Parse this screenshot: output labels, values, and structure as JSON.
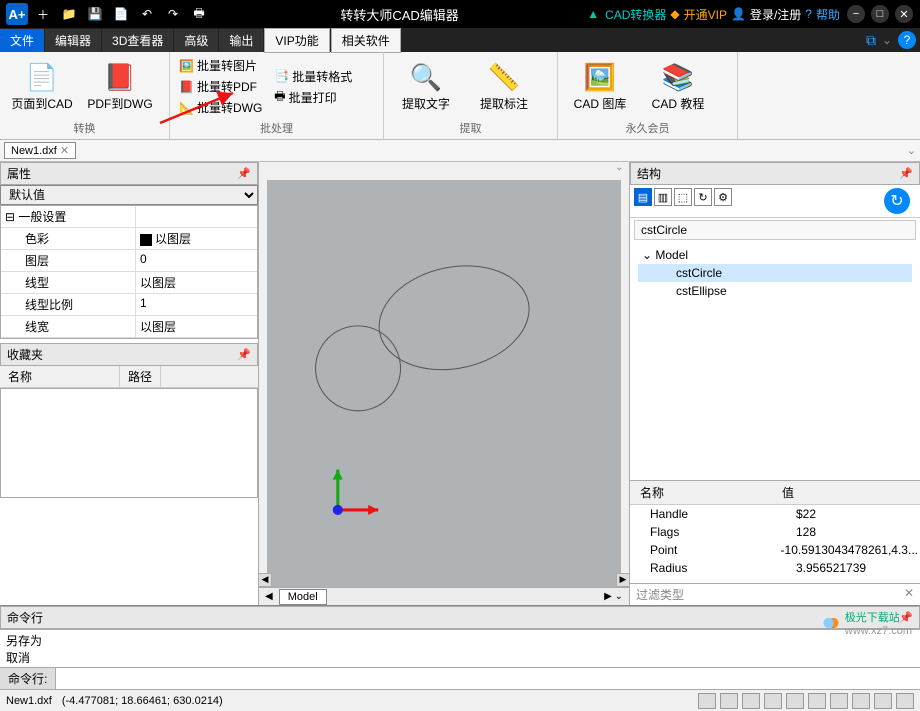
{
  "titlebar": {
    "app_name": "转转大师CAD编辑器",
    "links": {
      "converter": "CAD转换器",
      "vip": "开通VIP",
      "login": "登录/注册",
      "help": "帮助"
    }
  },
  "menus": [
    "文件",
    "编辑器",
    "3D查看器",
    "高级",
    "输出",
    "VIP功能",
    "相关软件"
  ],
  "ribbon": {
    "conv": {
      "label": "转换",
      "btn1": "页面到CAD",
      "btn2": "PDF到DWG"
    },
    "batch": {
      "label": "批处理",
      "b1": "批量转图片",
      "b2": "批量转PDF",
      "b3": "批量转DWG",
      "b4": "批量转格式",
      "b5": "批量打印"
    },
    "extract": {
      "label": "提取",
      "b1": "提取文字",
      "b2": "提取标注"
    },
    "vip": {
      "label": "永久会员",
      "b1": "CAD 图库",
      "b2": "CAD 教程"
    }
  },
  "doctab": "New1.dxf",
  "prop_panel": {
    "title": "属性",
    "default": "默认值",
    "group": "一般设置",
    "rows": [
      {
        "k": "色彩",
        "v": "以图层",
        "sw": true
      },
      {
        "k": "图层",
        "v": "0"
      },
      {
        "k": "线型",
        "v": "以图层"
      },
      {
        "k": "线型比例",
        "v": "1"
      },
      {
        "k": "线宽",
        "v": "以图层"
      }
    ]
  },
  "fav_panel": {
    "title": "收藏夹",
    "col1": "名称",
    "col2": "路径"
  },
  "struct_panel": {
    "title": "结构",
    "crumb": "cstCircle",
    "tree": {
      "root": "Model",
      "children": [
        "cstCircle",
        "cstEllipse"
      ]
    },
    "details": {
      "h1": "名称",
      "h2": "值",
      "rows": [
        {
          "k": "Handle",
          "v": "$22"
        },
        {
          "k": "Flags",
          "v": "128"
        },
        {
          "k": "Point",
          "v": "-10.5913043478261,4.3..."
        },
        {
          "k": "Radius",
          "v": "3.956521739"
        }
      ]
    },
    "filter": "过滤类型"
  },
  "canvas": {
    "tab": "Model"
  },
  "cmd": {
    "title": "命令行",
    "hist1": "另存为",
    "hist2": "取消",
    "label": "命令行:"
  },
  "status": {
    "file": "New1.dxf",
    "coords": "(-4.477081; 18.66461; 630.0214)"
  },
  "watermark": {
    "site": "www.xz7.com",
    "name": "极光下载站"
  }
}
